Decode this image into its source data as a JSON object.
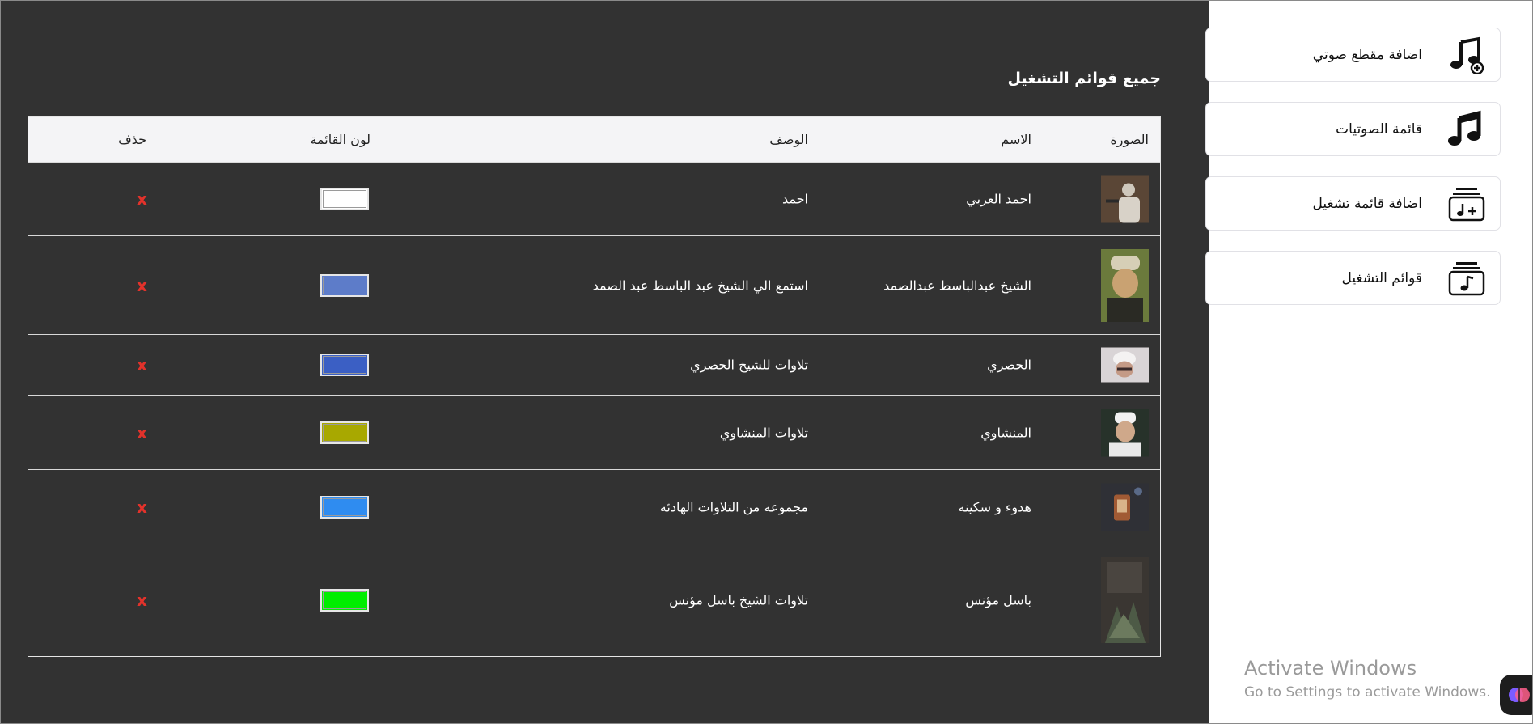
{
  "main": {
    "title": "جميع قوائم التشغيل",
    "table": {
      "headers": {
        "image": "الصورة",
        "name": "الاسم",
        "description": "الوصف",
        "color": "لون القائمة",
        "delete": "حذف"
      },
      "rows": [
        {
          "name": "احمد العربي",
          "description": "احمد",
          "color": "#ffffff",
          "delete": "x",
          "thumb_color": "#6e5a44"
        },
        {
          "name": "الشيخ عبدالباسط عبدالصمد",
          "description": "استمع الي الشيخ عبد الباسط عبد الصمد",
          "color": "#5d7cc9",
          "delete": "x",
          "thumb_color": "#7a6a3c"
        },
        {
          "name": "الحصري",
          "description": "تلاوات للشيخ الحصري",
          "color": "#3b5fc4",
          "delete": "x",
          "thumb_color": "#c9c2c4"
        },
        {
          "name": "المنشاوي",
          "description": "تلاوات المنشاوي",
          "color": "#a8a800",
          "delete": "x",
          "thumb_color": "#3a4a3a"
        },
        {
          "name": "هدوء و سكينه",
          "description": "مجموعه من التلاوات الهادئه",
          "color": "#2f8cf0",
          "delete": "x",
          "thumb_color": "#4a3e36"
        },
        {
          "name": "باسل مؤنس",
          "description": "تلاوات الشيخ باسل مؤنس",
          "color": "#00ee00",
          "delete": "x",
          "thumb_color": "#3a4238"
        }
      ]
    }
  },
  "sidebar": {
    "items": [
      {
        "label": "اضافة مقطع صوتي",
        "icon": "music-note-add-icon"
      },
      {
        "label": "قائمة الصوتيات",
        "icon": "music-note-icon"
      },
      {
        "label": "اضافة قائمة تشغيل",
        "icon": "playlist-add-icon"
      },
      {
        "label": "قوائم التشغيل",
        "icon": "playlist-icon"
      }
    ]
  },
  "watermark": {
    "title": "Activate Windows",
    "subtitle": "Go to Settings to activate Windows."
  },
  "fab": {
    "icon": "brain-icon"
  }
}
